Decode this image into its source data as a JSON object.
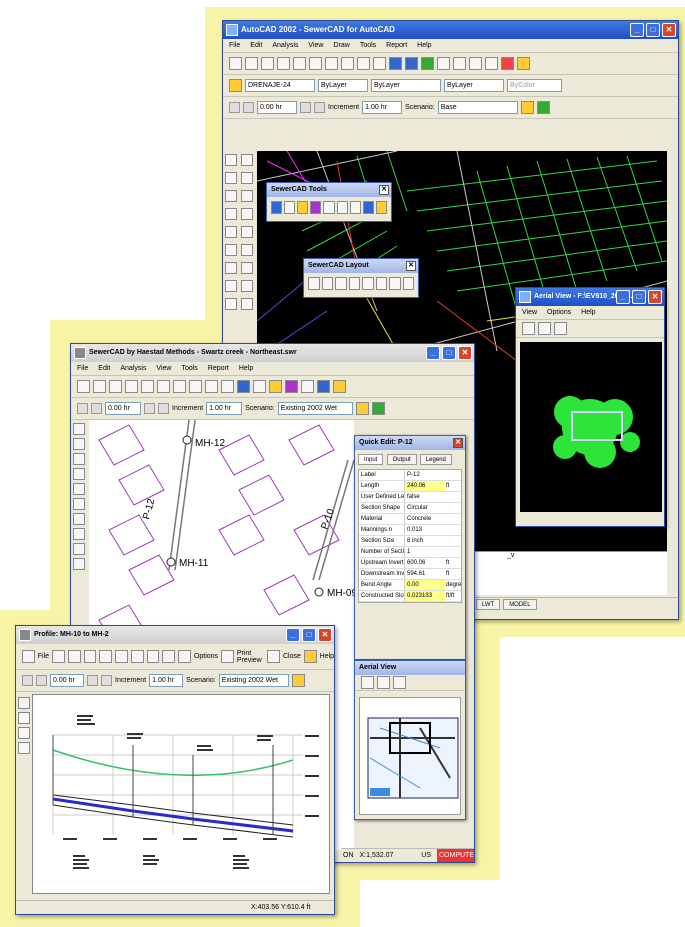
{
  "colors": {
    "backdrop": "#f7f4a7",
    "title_blue": "#2a5bd7",
    "highlight": "#ffff8c"
  },
  "autocad": {
    "title": "AutoCAD 2002 - SewerCAD for AutoCAD",
    "menu": [
      "File",
      "Edit",
      "Analysis",
      "View",
      "Draw",
      "Tools",
      "Report",
      "Help"
    ],
    "layer": "DRENAJE-24",
    "bylayer_color": "ByLayer",
    "bylayer_linetype": "ByLayer",
    "bylayer_lineweight": "ByLayer",
    "bycolor": "ByColor",
    "time": "0.00 hr",
    "increment_label": "Increment",
    "increment": "1.00 hr",
    "scenario_label": "Scenario:",
    "scenario": "Base",
    "command_text": "_v",
    "status_tabs": [
      "LWT",
      "MODEL"
    ]
  },
  "tools_palette": {
    "title": "SewerCAD Tools"
  },
  "layout_palette": {
    "title": "SewerCAD Layout"
  },
  "aerial_top": {
    "title": "Aerial View - F:\\EV910_2005...",
    "menu": [
      "View",
      "Options",
      "Help"
    ]
  },
  "sewercad": {
    "title": "SewerCAD by Haestad Methods - Swartz creek - Northeast.swr",
    "menu": [
      "File",
      "Edit",
      "Analysis",
      "View",
      "Tools",
      "Report",
      "Help"
    ],
    "time": "0.00 hr",
    "increment_label": "Increment",
    "increment": "1.00 hr",
    "scenario_label": "Scenario:",
    "scenario": "Existing 2002 Wet",
    "nodes": [
      "MH-12",
      "MH-11",
      "MH-09"
    ],
    "pipes": [
      "P-12",
      "P-10"
    ],
    "status": "X:1,532.07 Y:1,273.45 ft",
    "status_left": "ON",
    "status_units": "US",
    "status_compute": "COMPUTE"
  },
  "quick_edit": {
    "title": "Quick Edit: P-12",
    "tabs": [
      "Input",
      "Output",
      "Legend"
    ],
    "rows": [
      {
        "k": "Label",
        "v": "P-12",
        "u": ""
      },
      {
        "k": "Length",
        "v": "240.06",
        "u": "ft",
        "hl": true
      },
      {
        "k": "User Defined Len",
        "v": "false",
        "u": ""
      },
      {
        "k": "Section Shape",
        "v": "Circular",
        "u": ""
      },
      {
        "k": "Material",
        "v": "Concrete",
        "u": ""
      },
      {
        "k": "Mannings n",
        "v": "0.013",
        "u": ""
      },
      {
        "k": "Section Size",
        "v": "8 inch",
        "u": ""
      },
      {
        "k": "Number of Sectio",
        "v": "1",
        "u": ""
      },
      {
        "k": "Upstream Invert",
        "v": "600.06",
        "u": "ft"
      },
      {
        "k": "Downstream Inve",
        "v": "594.61",
        "u": "ft"
      },
      {
        "k": "Bend Angle",
        "v": "0.00",
        "u": "degre",
        "hl": true
      },
      {
        "k": "Constructed Slop",
        "v": "0.023133",
        "u": "ft/ft",
        "hl": true
      }
    ]
  },
  "aerial_small": {
    "title": "Aerial View"
  },
  "profile": {
    "title": "Profile: MH-10 to MH-2",
    "buttons": [
      "File",
      "Options",
      "Print Preview",
      "Close",
      "Help"
    ],
    "time": "0.00 hr",
    "increment_label": "Increment",
    "increment": "1.00 hr",
    "scenario_label": "Scenario:",
    "scenario": "Existing 2002 Wet",
    "status": "X:403.56  Y:610.4 ft"
  }
}
